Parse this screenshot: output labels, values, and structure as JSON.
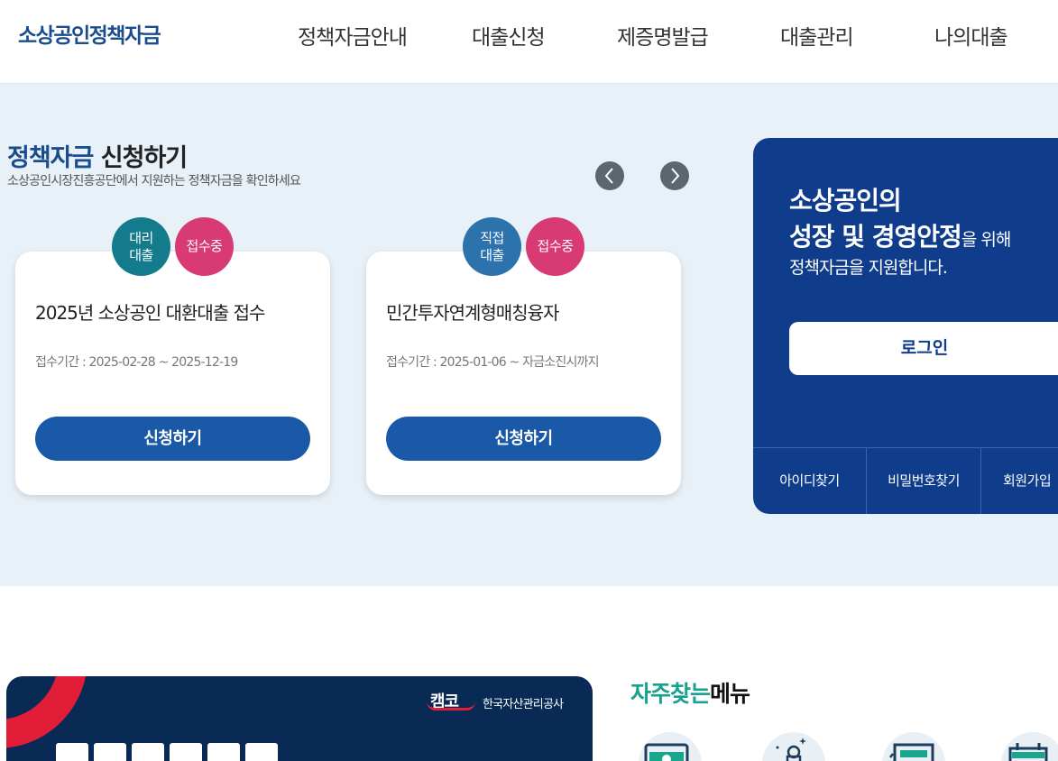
{
  "header": {
    "logo": "소상공인정책자금",
    "nav": [
      "정책자금안내",
      "대출신청",
      "제증명발급",
      "대출관리",
      "나의대출"
    ]
  },
  "hero": {
    "title_highlight": "정책자금",
    "title_rest": " 신청하기",
    "subtitle": "소상공인시장진흥공단에서 지원하는 정책자금을 확인하세요",
    "cards": [
      {
        "type_badge_line1": "대리",
        "type_badge_line2": "대출",
        "status_badge": "접수중",
        "title": "2025년 소상공인 대환대출 접수",
        "period": "접수기간 : 2025-02-28 ~ 2025-12-19",
        "button": "신청하기"
      },
      {
        "type_badge_line1": "직접",
        "type_badge_line2": "대출",
        "status_badge": "접수중",
        "title": "민간투자연계형매칭융자",
        "period": "접수기간 : 2025-01-06 ~ 자금소진시까지",
        "button": "신청하기"
      }
    ]
  },
  "login_panel": {
    "line1": "소상공인의",
    "line2_strong": "성장 및 경영안정",
    "line2_light": "을 위해",
    "line3": "정책자금을 지원합니다.",
    "login_button": "로그인",
    "links": [
      "아이디찾기",
      "비밀번호찾기",
      "회원가입"
    ]
  },
  "banner": {
    "logo_text": "캠코",
    "org_name": "한국자산관리공사"
  },
  "favorites": {
    "title_highlight": "자주찾는",
    "title_rest": "메뉴"
  },
  "colors": {
    "brand_blue": "#1a59a8",
    "panel_navy": "#0f3d8c",
    "teal_badge": "#137b8c",
    "pink_badge": "#d83a74",
    "band_bg": "#e8f0f8"
  }
}
